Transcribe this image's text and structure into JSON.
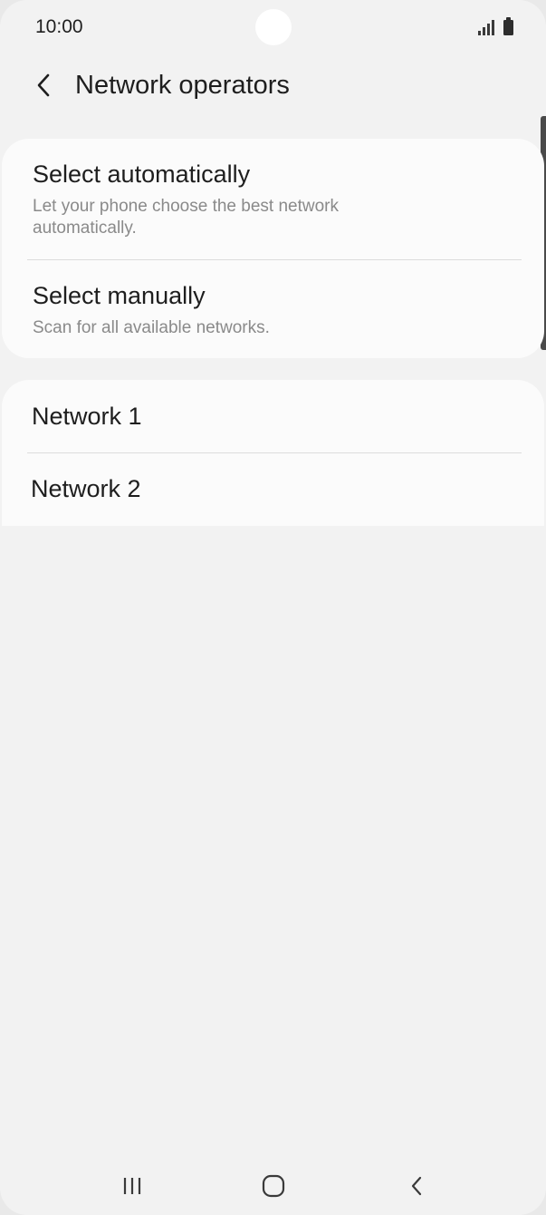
{
  "status_bar": {
    "time": "10:00",
    "icons": [
      "signal-icon",
      "battery-icon"
    ]
  },
  "header": {
    "back_icon": "chevron-left-icon",
    "title": "Network operators"
  },
  "options": [
    {
      "title": "Select automatically",
      "description": "Let your phone choose the best network automatically."
    },
    {
      "title": "Select manually",
      "description": "Scan for all available networks."
    }
  ],
  "networks": [
    {
      "label": "Network 1"
    },
    {
      "label": "Network 2"
    }
  ],
  "nav_bar": {
    "icons": [
      "recent-apps-icon",
      "home-icon",
      "back-icon"
    ]
  },
  "colors": {
    "background": "#f2f2f2",
    "card": "#fbfbfb",
    "primary_text": "#1e1e1e",
    "secondary_text": "#8a8a8a",
    "divider": "#dcdcdc"
  }
}
